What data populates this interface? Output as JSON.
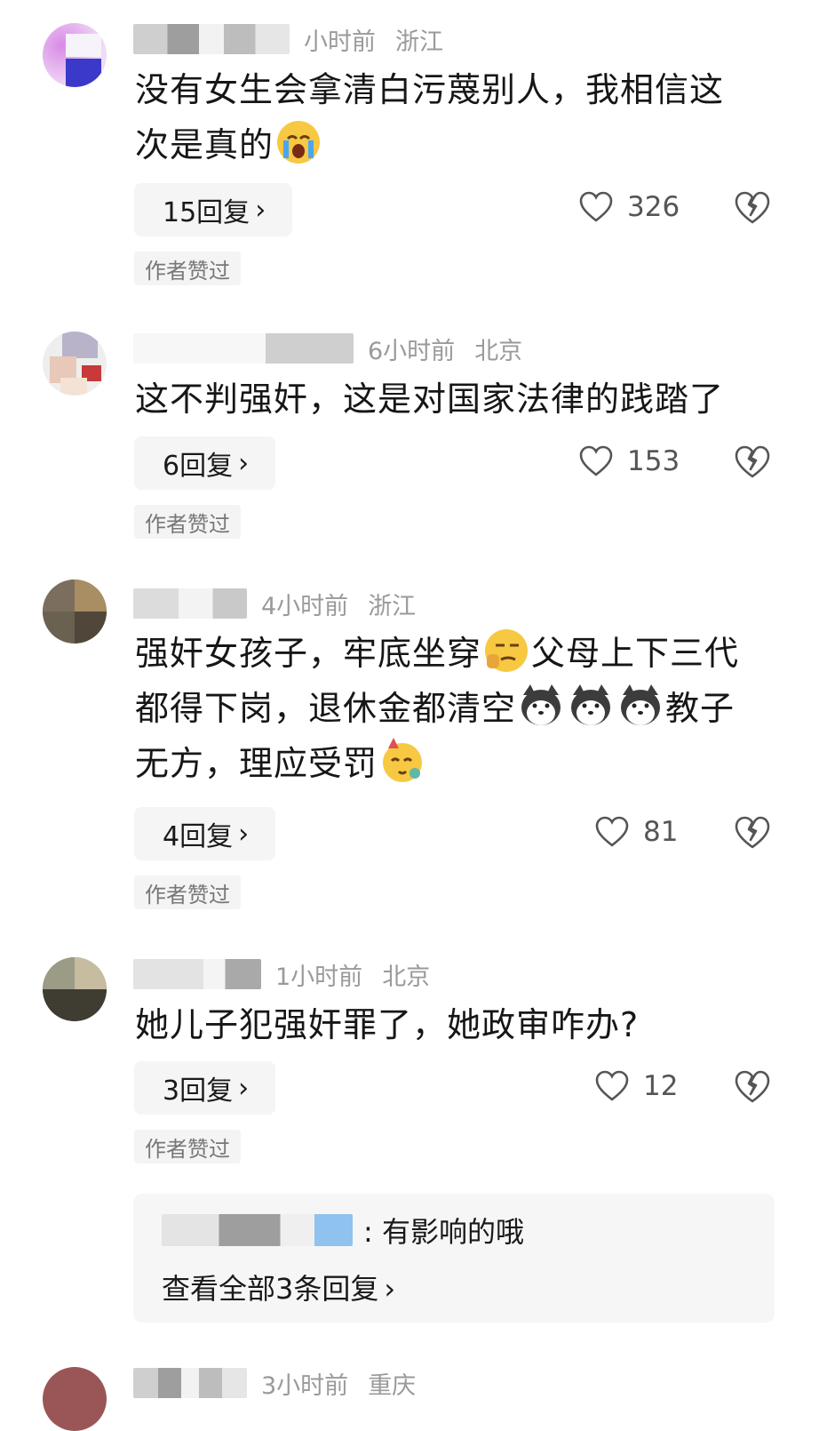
{
  "comments": [
    {
      "time": "小时前",
      "location": "浙江",
      "text_parts": [
        "没有女生会拿清白污蔑别人，我相信这",
        "次是真的"
      ],
      "emojis": [
        "crying-emoji"
      ],
      "reply_label": "15回复",
      "likes": "326",
      "author_tag": "作者赞过"
    },
    {
      "time": "6小时前",
      "location": "北京",
      "text_parts": [
        "这不判强奸，这是对国家法律的践踏了"
      ],
      "emojis": [],
      "reply_label": "6回复",
      "likes": "153",
      "author_tag": "作者赞过"
    },
    {
      "time": "4小时前",
      "location": "浙江",
      "text_parts": [
        "强奸女孩子，牢底坐穿",
        "父母上下三代",
        "都得下岗，退休金都清空",
        "教子",
        "无方，理应受罚"
      ],
      "emojis": [
        "smirk-thinking-emoji",
        "husky-dog-emoji",
        "husky-dog-emoji",
        "husky-dog-emoji",
        "party-emoji"
      ],
      "reply_label": "4回复",
      "likes": "81",
      "author_tag": "作者赞过"
    },
    {
      "time": "1小时前",
      "location": "北京",
      "text_parts": [
        "她儿子犯强奸罪了，她政审咋办?"
      ],
      "emojis": [],
      "reply_label": "3回复",
      "likes": "12",
      "author_tag": "作者赞过"
    }
  ],
  "sub_reply": {
    "text": ": 有影响的哦",
    "view_all": "查看全部3条回复"
  },
  "partial_comment": {
    "time": "3小时前",
    "location": "重庆"
  },
  "chevron": "›",
  "colors": {
    "muted_text": "#9a9a9a",
    "reply_bg": "#f5f5f5",
    "body_text": "#161616"
  }
}
